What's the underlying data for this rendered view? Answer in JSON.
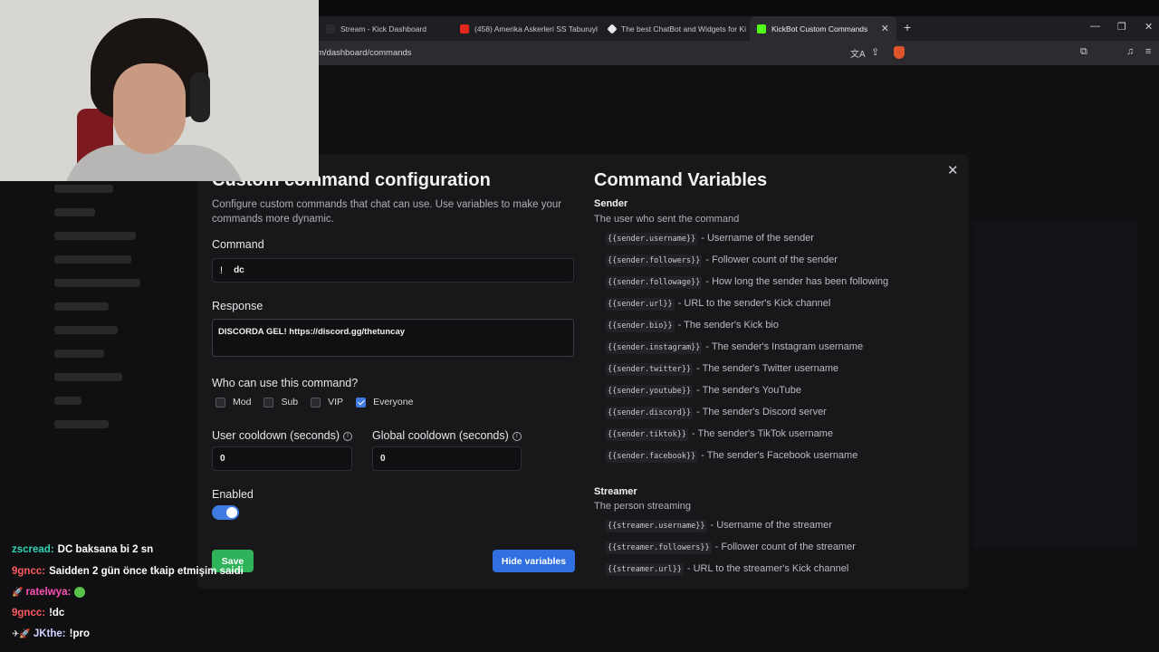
{
  "browser": {
    "tabs": [
      {
        "label": "Stream - Kick Dashboard",
        "fav_color": "#2a2a2f"
      },
      {
        "label": "(458) Amerika Askerleri SS Taburuyla",
        "fav_color": "#e5281e"
      },
      {
        "label": "The best ChatBot and Widgets for Ki",
        "fav_color": "#e8e8ec"
      },
      {
        "label": "KickBot Custom Commands",
        "fav_color": "#53fc18"
      }
    ],
    "new_tab": "+",
    "tab_close": "✕",
    "url": "m/dashboard/commands",
    "window_controls": {
      "minimize": "—",
      "restore": "❐",
      "close": "✕"
    },
    "toolbar_icons": {
      "translate": "文A",
      "share": "⇪",
      "extensions": "⧉",
      "media": "♫",
      "menu": "≡"
    }
  },
  "modal": {
    "close_label": "✕",
    "title": "Custom command configuration",
    "subtitle": "Configure custom commands that chat can use. Use variables to make your commands more dynamic.",
    "command_label": "Command",
    "command_prefix": "!",
    "command_value": "dc",
    "response_label": "Response",
    "response_value": "DISCORDA GEL! https://discord.gg/thetuncay",
    "permissions_label": "Who can use this command?",
    "permissions": [
      {
        "label": "Mod",
        "checked": false
      },
      {
        "label": "Sub",
        "checked": false
      },
      {
        "label": "VIP",
        "checked": false
      },
      {
        "label": "Everyone",
        "checked": true
      }
    ],
    "user_cooldown_label": "User cooldown (seconds)",
    "user_cooldown_value": "0",
    "global_cooldown_label": "Global cooldown (seconds)",
    "global_cooldown_value": "0",
    "info_glyph": "i",
    "enabled_label": "Enabled",
    "enabled": true,
    "save_label": "Save",
    "hide_variables_label": "Hide variables"
  },
  "variables": {
    "title": "Command Variables",
    "sender": {
      "heading": "Sender",
      "description": "The user who sent the command",
      "items": [
        {
          "code": "{{sender.username}}",
          "desc": "- Username of the sender"
        },
        {
          "code": "{{sender.followers}}",
          "desc": "- Follower count of the sender"
        },
        {
          "code": "{{sender.followage}}",
          "desc": "- How long the sender has been following"
        },
        {
          "code": "{{sender.url}}",
          "desc": "- URL to the sender's Kick channel"
        },
        {
          "code": "{{sender.bio}}",
          "desc": "- The sender's Kick bio"
        },
        {
          "code": "{{sender.instagram}}",
          "desc": "- The sender's Instagram username"
        },
        {
          "code": "{{sender.twitter}}",
          "desc": "- The sender's Twitter username"
        },
        {
          "code": "{{sender.youtube}}",
          "desc": "- The sender's YouTube"
        },
        {
          "code": "{{sender.discord}}",
          "desc": "- The sender's Discord server"
        },
        {
          "code": "{{sender.tiktok}}",
          "desc": "- The sender's TikTok username"
        },
        {
          "code": "{{sender.facebook}}",
          "desc": "- The sender's Facebook username"
        }
      ]
    },
    "streamer": {
      "heading": "Streamer",
      "description": "The person streaming",
      "items": [
        {
          "code": "{{streamer.username}}",
          "desc": "- Username of the streamer"
        },
        {
          "code": "{{streamer.followers}}",
          "desc": "- Follower count of the streamer"
        },
        {
          "code": "{{streamer.url}}",
          "desc": "- URL to the streamer's Kick channel"
        }
      ]
    }
  },
  "chat": [
    {
      "user": "zscread:",
      "user_color": "#2ed3b7",
      "message": "DC baksana bi 2 sn",
      "badge": ""
    },
    {
      "user": "9gncc:",
      "user_color": "#ff5a5f",
      "message": "Saidden 2 gün önce tkaip etmişim saidi",
      "badge": ""
    },
    {
      "user": "ratelwya:",
      "user_color": "#ff4fb8",
      "message": "",
      "badge": "🚀",
      "emote": true
    },
    {
      "user": "9gncc:",
      "user_color": "#ff5a5f",
      "message": "!dc",
      "badge": ""
    },
    {
      "user": "JKthe:",
      "user_color": "#cfd3ff",
      "message": "!pro",
      "badge": "✈🚀"
    }
  ],
  "colors": {
    "accent_blue": "#2f6fe0",
    "save_green": "#2fb35a",
    "modal_bg": "#18181b"
  }
}
